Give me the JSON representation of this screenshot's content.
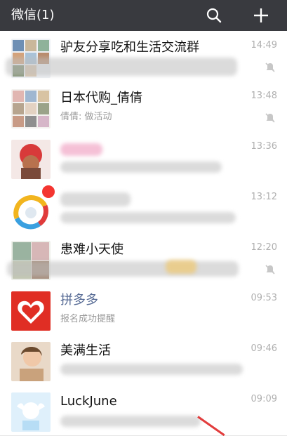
{
  "header": {
    "title": "微信(1)",
    "search_icon": "search-icon",
    "add_icon": "plus-icon"
  },
  "colors": {
    "topbar": "#393a3f",
    "badge": "#f43530",
    "link_name": "#576b95"
  },
  "chats": [
    {
      "name": "驴友分享吃和生活交流群",
      "preview": "",
      "time": "14:49",
      "muted": true
    },
    {
      "name": "日本代购_倩倩",
      "preview": "倩倩: 做活动",
      "time": "13:48",
      "muted": true
    },
    {
      "name": "",
      "preview": "",
      "time": "13:36",
      "muted": false
    },
    {
      "name": "",
      "preview": "",
      "time": "13:12",
      "muted": false,
      "badge": true
    },
    {
      "name": "患难小天使",
      "preview": "",
      "time": "12:20",
      "muted": true
    },
    {
      "name": "拼多多",
      "preview": "报名成功提醒",
      "time": "09:53",
      "muted": false
    },
    {
      "name": "美满生活",
      "preview": "",
      "time": "09:46",
      "muted": false
    },
    {
      "name": "LuckJune",
      "preview": "",
      "time": "09:09",
      "muted": false
    }
  ]
}
